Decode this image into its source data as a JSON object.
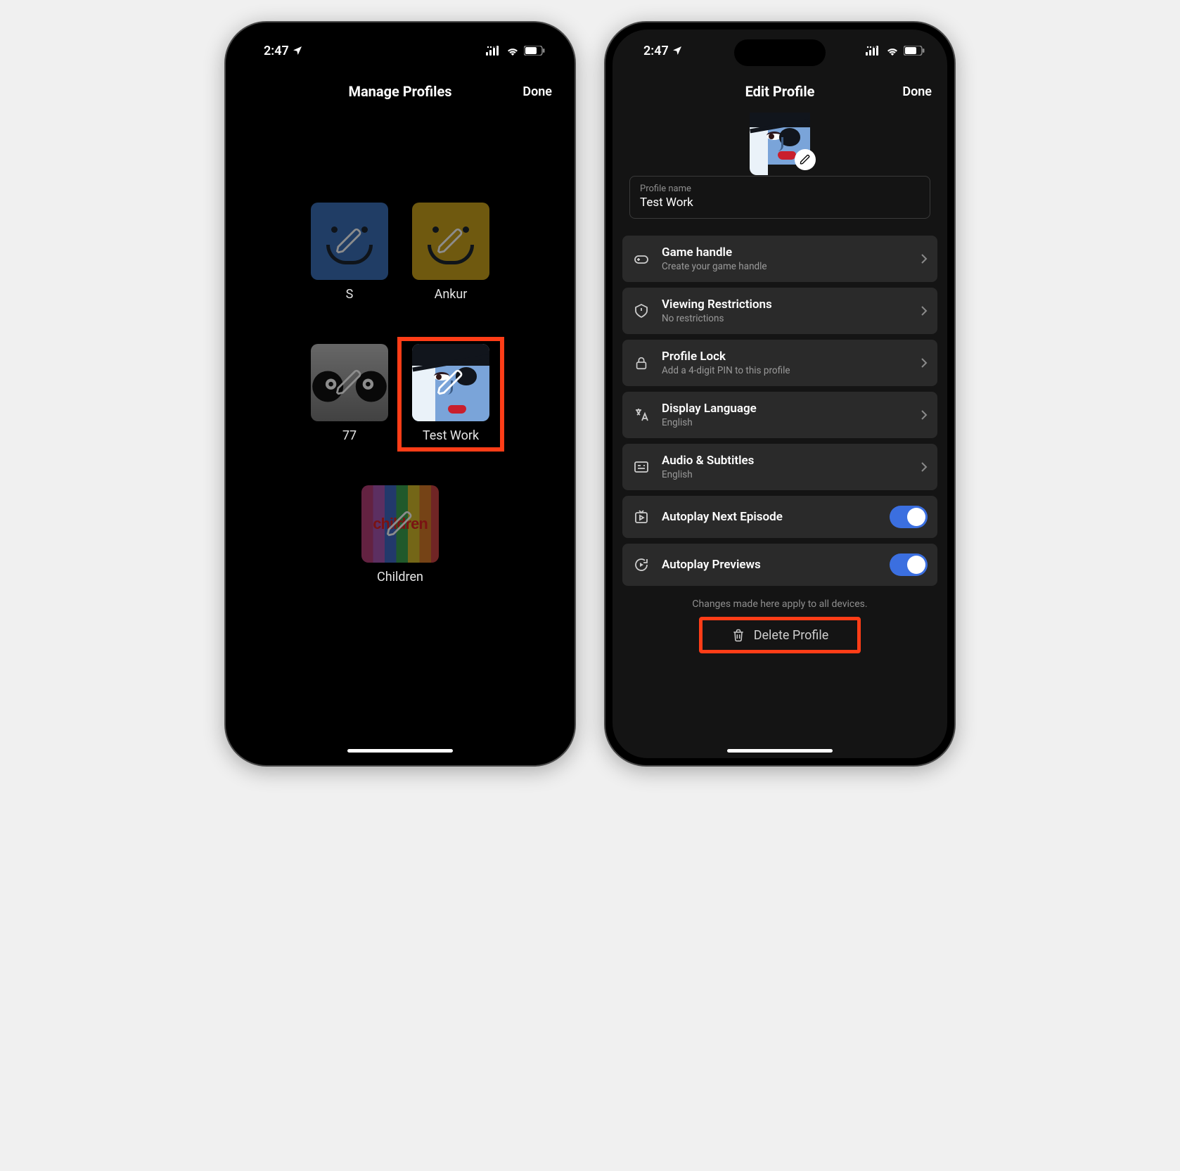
{
  "status": {
    "time": "2:47"
  },
  "left": {
    "title": "Manage Profiles",
    "done": "Done",
    "profiles": [
      {
        "name": "S"
      },
      {
        "name": "Ankur"
      },
      {
        "name": "77"
      },
      {
        "name": "Test Work"
      },
      {
        "name": "Children"
      }
    ]
  },
  "right": {
    "title": "Edit Profile",
    "done": "Done",
    "name_field": {
      "label": "Profile name",
      "value": "Test Work"
    },
    "rows": {
      "game": {
        "title": "Game handle",
        "sub": "Create your game handle"
      },
      "restrict": {
        "title": "Viewing Restrictions",
        "sub": "No restrictions"
      },
      "lock": {
        "title": "Profile Lock",
        "sub": "Add a 4-digit PIN to this profile"
      },
      "lang": {
        "title": "Display Language",
        "sub": "English"
      },
      "audio": {
        "title": "Audio & Subtitles",
        "sub": "English"
      },
      "auto_next": {
        "title": "Autoplay Next Episode",
        "on": true
      },
      "auto_prev": {
        "title": "Autoplay Previews",
        "on": true
      }
    },
    "footnote": "Changes made here apply to all devices.",
    "delete": "Delete Profile"
  }
}
